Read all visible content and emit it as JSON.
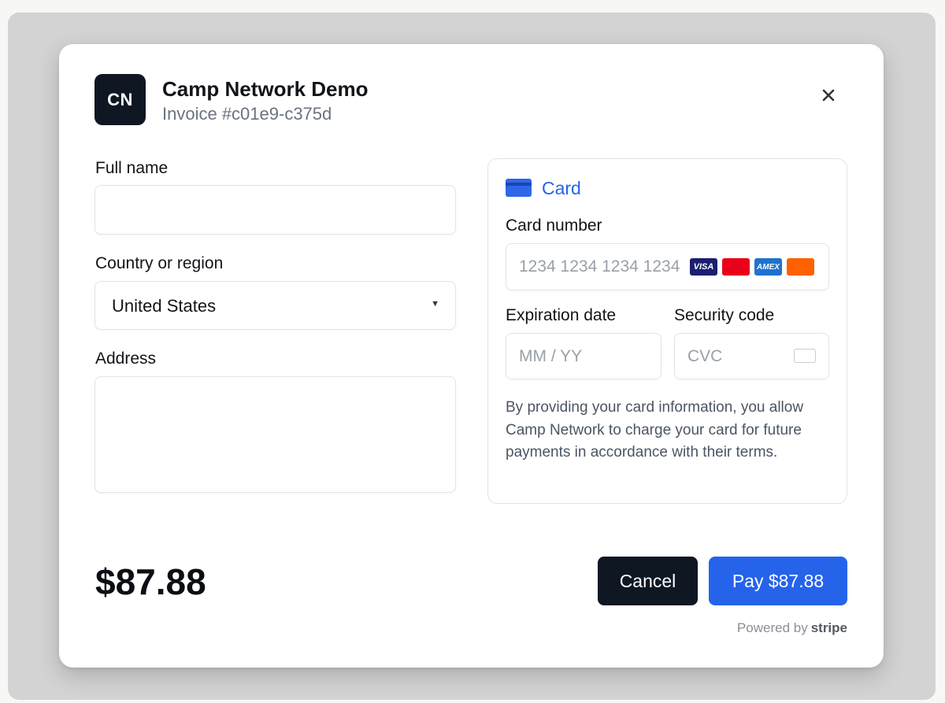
{
  "header": {
    "logo_initials": "CN",
    "merchant_name": "Camp Network Demo",
    "invoice": "Invoice #c01e9-c375d",
    "close_icon": "close-icon"
  },
  "billing": {
    "full_name_label": "Full name",
    "full_name_value": "",
    "country_label": "Country or region",
    "country_value": "United States",
    "address_label": "Address",
    "address_value": ""
  },
  "card": {
    "tab_label": "Card",
    "tab_icon": "credit-card-icon",
    "number_label": "Card number",
    "number_placeholder": "1234 1234 1234 1234",
    "brands": [
      {
        "name": "visa",
        "label": "VISA",
        "color": "#1a1f71"
      },
      {
        "name": "mastercard",
        "label": "",
        "color": "#eb001b"
      },
      {
        "name": "amex",
        "label": "AMEX",
        "color": "#1f72cd"
      },
      {
        "name": "discover",
        "label": "",
        "color": "#ff6000"
      }
    ],
    "expiry_label": "Expiration date",
    "expiry_placeholder": "MM / YY",
    "cvc_label": "Security code",
    "cvc_placeholder": "CVC",
    "consent": "By providing your card information, you allow Camp Network to charge your card for future payments in accordance with their terms."
  },
  "footer": {
    "total": "$87.88",
    "cancel_label": "Cancel",
    "pay_label": "Pay $87.88",
    "powered_by": "Powered by",
    "powered_brand": "stripe"
  },
  "colors": {
    "accent": "#2563eb",
    "dark": "#0f1723",
    "muted": "#6b7280"
  }
}
